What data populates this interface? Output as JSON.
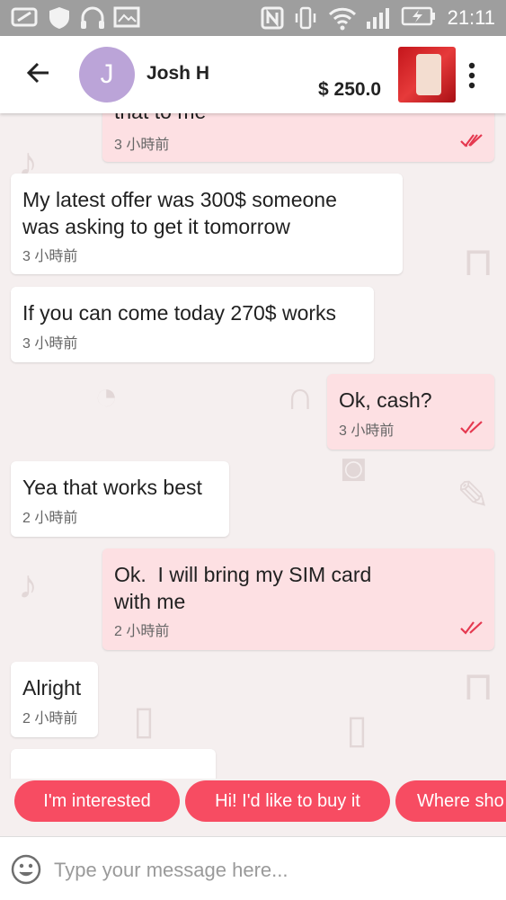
{
  "status_bar": {
    "time": "21:11"
  },
  "header": {
    "contact_initial": "J",
    "contact_name": "Josh H",
    "price": "$ 250.0"
  },
  "messages": [
    {
      "direction": "outgoing",
      "text": "that to me",
      "time": "3 小時前",
      "read": true
    },
    {
      "direction": "incoming",
      "text": "My latest offer was 300$ someone\nwas asking to get it tomorrow",
      "time": "3 小時前"
    },
    {
      "direction": "incoming",
      "text": "If you can come today 270$ works",
      "time": "3 小時前"
    },
    {
      "direction": "outgoing",
      "text": "Ok, cash?",
      "time": "3 小時前",
      "read": true
    },
    {
      "direction": "incoming",
      "text": "Yea that works best",
      "time": "2 小時前"
    },
    {
      "direction": "outgoing",
      "text": "Ok.  I will bring my SIM card\nwith me",
      "time": "2 小時前",
      "read": true
    },
    {
      "direction": "incoming",
      "text": "Alright",
      "time": "2 小時前"
    }
  ],
  "quick_replies": [
    "I'm interested",
    "Hi! I'd like to buy it",
    "Where sho"
  ],
  "composer": {
    "placeholder": "Type your message here..."
  },
  "colors": {
    "accent": "#f74c62",
    "outgoing_bubble": "#fde0e3",
    "read_tick": "#e53950"
  }
}
